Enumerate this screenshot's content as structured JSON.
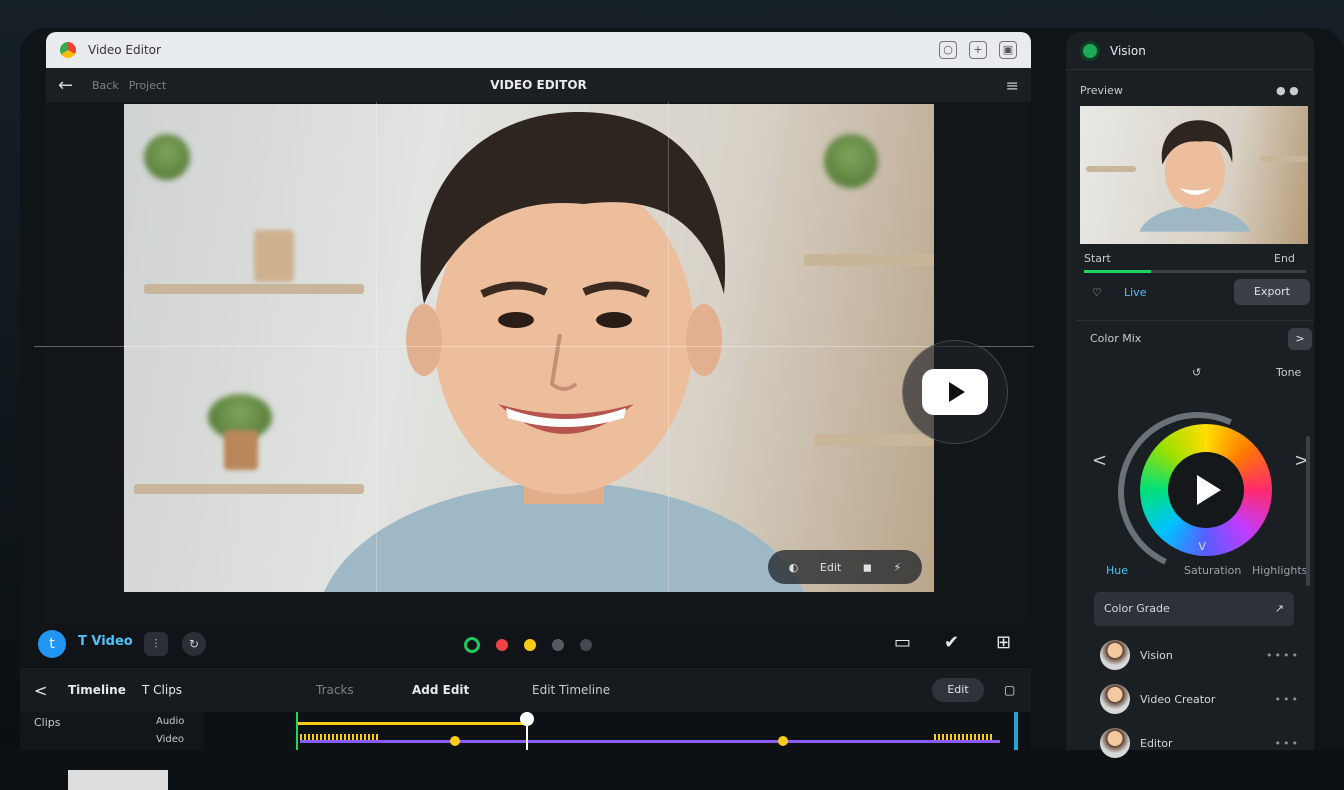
{
  "browser": {
    "tab_label": "Video Editor",
    "new_tab": "+",
    "search_glyph": "○",
    "window_glyph": "▣"
  },
  "header": {
    "title": "VIDEO EDITOR",
    "back_glyph": "←",
    "crumb1": "Back",
    "crumb2": "Project",
    "menu_glyph": "≡"
  },
  "video": {
    "pill_items": [
      "◐",
      "Edit",
      "◼",
      "⚡"
    ]
  },
  "toolbar": {
    "tool_badge": "t",
    "tool_name": "T Video",
    "icon_a": "⫶",
    "icon_b": "↻",
    "colors": [
      "#22c55e",
      "#ef4444",
      "#facc15",
      "#555b60",
      "#444a4f"
    ],
    "right_icons": [
      "▭",
      "✔",
      "⊞"
    ]
  },
  "timeline": {
    "back_glyph": "<",
    "label1": "Timeline",
    "label2": "T Clips",
    "label3": "Tracks",
    "center": "Add Edit",
    "right_text": "Edit Timeline",
    "button": "Edit",
    "row_label": "Clips",
    "track_label": "Audio",
    "track_label2": "Video"
  },
  "panel": {
    "name": "Vision",
    "section1": "Preview",
    "section1_right": "● ●",
    "left_time": "Start",
    "right_time": "End",
    "preview_label": "Live",
    "preview_button": "Export",
    "section2": "Color Mix",
    "next_glyph": ">",
    "wheel_top": "↺",
    "wheel_top_right": "Tone",
    "prev_arrow": "<",
    "next_arrow": ">",
    "down_arrow": "v",
    "tabs": [
      "Hue",
      "Saturation",
      "Highlights"
    ],
    "field_label": "Color Grade",
    "field_glyph": "↗",
    "users": [
      {
        "name": "Vision",
        "more": "••••"
      },
      {
        "name": "Video Creator",
        "more": "•••"
      },
      {
        "name": "Editor",
        "more": "•••"
      }
    ]
  }
}
